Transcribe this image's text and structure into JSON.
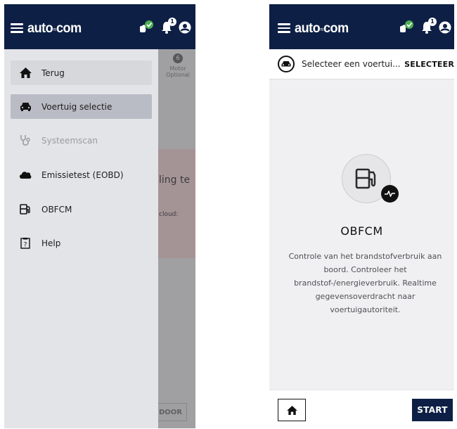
{
  "brand": {
    "logo_left": "auto",
    "logo_sep": "≈",
    "logo_right": "com",
    "primary": "#0e1f45",
    "check": "#4caf50"
  },
  "topbar": {
    "notification_count": "1"
  },
  "left": {
    "background": {
      "motor_num": "6",
      "motor_label": "Motor",
      "motor_sub": "Optional",
      "card_title": "ling te",
      "card_text": "cloud:",
      "door_button": "DOOR"
    },
    "menu": [
      {
        "label": "Terug",
        "icon": "home-icon"
      },
      {
        "label": "Voertuig selectie",
        "icon": "car-icon"
      },
      {
        "label": "Systeemscan",
        "icon": "stethoscope-icon"
      },
      {
        "label": "Emissietest (EOBD)",
        "icon": "emission-cloud-icon"
      },
      {
        "label": "OBFCM",
        "icon": "fuel-pump-icon"
      },
      {
        "label": "Help",
        "icon": "help-icon"
      }
    ]
  },
  "right": {
    "select_text": "Selecteer een voertui...",
    "select_button": "SELECTEER",
    "title": "OBFCM",
    "description": "Controle van het brandstofverbruik aan boord. Controleer het brandstof-/energieverbruik. Realtime gegevensoverdracht naar voertuigautoriteit.",
    "start_button": "START"
  }
}
